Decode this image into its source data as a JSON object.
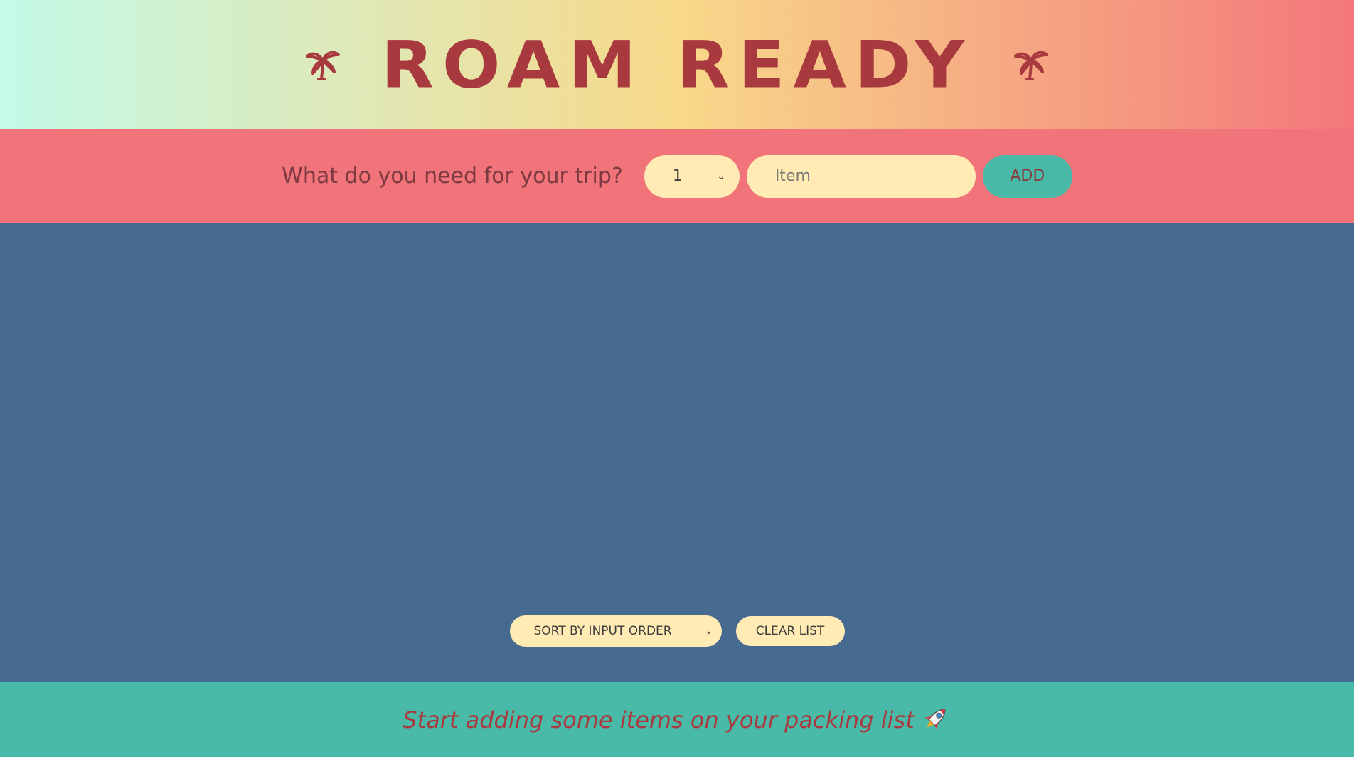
{
  "header": {
    "title": "ROAM READY",
    "left_icon": "palm-tree-icon",
    "right_icon": "palm-tree-icon",
    "gradient": [
      "#c3fae8",
      "#f8d98a",
      "#f4777b"
    ],
    "title_color": "#a83a3f"
  },
  "form": {
    "question": "What do you need for your trip?",
    "quantity_selected": "1",
    "item_placeholder": "Item",
    "item_value": "",
    "add_label": "ADD",
    "background": "#f07479"
  },
  "list": {
    "background": "#466a90",
    "items": [],
    "sort_selected": "SORT BY INPUT ORDER",
    "clear_label": "CLEAR LIST"
  },
  "footer": {
    "message": "Start adding some items on your packing list",
    "icon": "rocket-icon",
    "background": "#4abaa8"
  }
}
